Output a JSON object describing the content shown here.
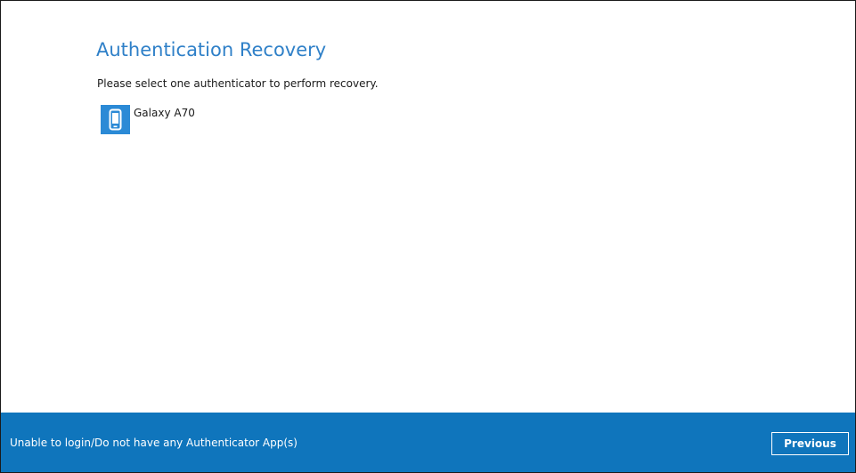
{
  "page": {
    "title": "Authentication Recovery",
    "instruction": "Please select one authenticator to perform recovery."
  },
  "authenticators": [
    {
      "name": "Galaxy A70",
      "icon": "smartphone-icon",
      "icon_color": "#2b8ad6"
    }
  ],
  "footer": {
    "help_link": "Unable to login/Do not have any Authenticator App(s)",
    "previous_label": "Previous",
    "background_color": "#0f75bc"
  },
  "colors": {
    "title": "#2f80c8",
    "text": "#1a1a1a"
  }
}
